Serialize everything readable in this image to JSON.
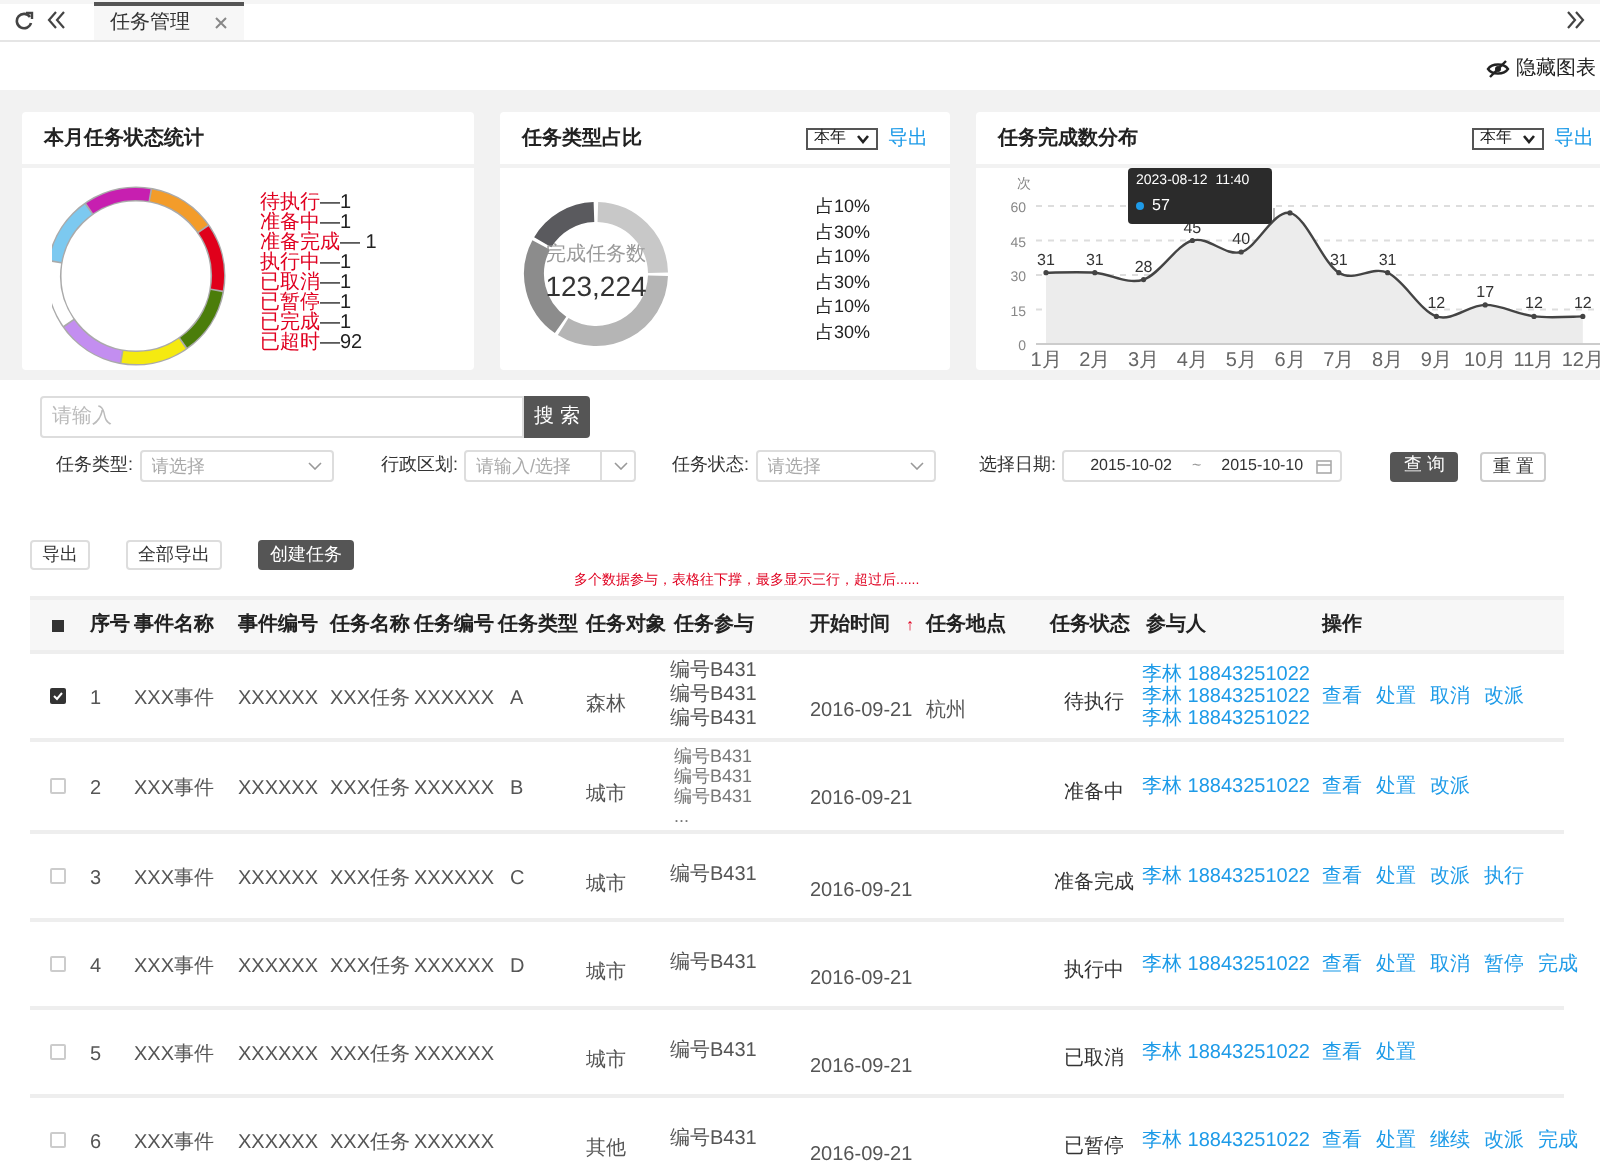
{
  "tab_bar": {
    "tabs": [
      {
        "label": "任务管理",
        "selected": true
      }
    ]
  },
  "hide_charts": "隐藏图表",
  "status_card": {
    "title": "本月任务状态统计",
    "ring_segments": [
      {
        "color": "#c71fb0"
      },
      {
        "color": "#f39c2a"
      },
      {
        "color": "#e0001b"
      },
      {
        "color": "#4b7d0a"
      },
      {
        "color": "#f5ea10"
      },
      {
        "color": "#c38ef0"
      },
      {
        "color": "#ffffff"
      },
      {
        "color": "#7cc9f0"
      }
    ],
    "legend": [
      {
        "label": "待执行",
        "count": "—1"
      },
      {
        "label": "准备中",
        "count": "—1"
      },
      {
        "label": "准备完成",
        "count": "— 1"
      },
      {
        "label": "执行中",
        "count": "—1"
      },
      {
        "label": "已取消",
        "count": "—1"
      },
      {
        "label": "已暂停",
        "count": "—1"
      },
      {
        "label": "已完成",
        "count": "—1"
      },
      {
        "label": "已超时",
        "count": "—92"
      }
    ]
  },
  "type_card": {
    "title": "任务类型占比",
    "period": "本年",
    "export": "导出",
    "center_label": "完成任务数",
    "center_value": "123,224",
    "ring_segments": [
      {
        "color": "#c8c8c8"
      },
      {
        "color": "#b5b5b5"
      },
      {
        "color": "#8c8c8c"
      },
      {
        "color": "#5a5a5e"
      }
    ],
    "legend": [
      "占10%",
      "占30%",
      "占10%",
      "占30%",
      "占10%",
      "占30%"
    ]
  },
  "trend_card": {
    "title": "任务完成数分布",
    "period": "本年",
    "export": "导出",
    "chart_data": {
      "type": "area",
      "grid": true,
      "ylabel": "次",
      "categories": [
        "1月",
        "2月",
        "3月",
        "4月",
        "5月",
        "6月",
        "7月",
        "8月",
        "9月",
        "10月",
        "11月",
        "12月"
      ],
      "values": [
        31,
        31,
        28,
        45,
        40,
        57,
        31,
        31,
        12,
        17,
        12,
        12
      ],
      "yticks": [
        0,
        15,
        30,
        45,
        60
      ],
      "ylim": [
        0,
        60
      ],
      "value_labels": [
        "31",
        "31",
        "28",
        "45",
        "40",
        null,
        "31",
        "31",
        "12",
        "17",
        "12",
        "12"
      ]
    },
    "tooltip": {
      "date": "2023-08-12  11:40",
      "value": "57"
    }
  },
  "search": {
    "placeholder": "请输入",
    "button": "搜 索"
  },
  "filters": [
    {
      "label": "任务类型:",
      "placeholder": "请选择",
      "kind": "select"
    },
    {
      "label": "行政区划:",
      "placeholder": "请输入/选择",
      "kind": "combo"
    },
    {
      "label": "任务状态:",
      "placeholder": "请选择",
      "kind": "select"
    }
  ],
  "date_filter": {
    "label": "选择日期:",
    "start": "2015-10-02",
    "separator": "~",
    "end": "2015-10-10"
  },
  "query_button": "查 询",
  "reset_button": "重 置",
  "actions": [
    {
      "label": "导出",
      "kind": "plain"
    },
    {
      "label": "全部导出",
      "kind": "plain"
    },
    {
      "label": "创建任务",
      "kind": "primary"
    }
  ],
  "note": "多个数据参与，表格往下撑，最多显示三行，超过后......",
  "table": {
    "select_all": {
      "indeterminate": true
    },
    "columns": [
      {
        "label": "序号"
      },
      {
        "label": "事件名称"
      },
      {
        "label": "事件编号"
      },
      {
        "label": "任务名称"
      },
      {
        "label": "任务编号"
      },
      {
        "label": "任务类型"
      },
      {
        "label": "任务对象"
      },
      {
        "label": "任务参与"
      },
      {
        "label": "开始时间",
        "sort_mark": "↑"
      },
      {
        "label": "任务地点"
      },
      {
        "label": "任务状态"
      },
      {
        "label": "参与人"
      },
      {
        "label": "操作"
      }
    ],
    "rows": [
      {
        "checked": true,
        "no": "1",
        "event_name": "XXX事件",
        "event_no": "XXXXXX",
        "task_name": "XXX任务",
        "task_no": "XXXXXX",
        "type": "A",
        "object": "森林",
        "participants": [
          "编号B431",
          "编号B431",
          "编号B431"
        ],
        "start": "2016-09-21",
        "place": "杭州",
        "status": "待执行",
        "people": [
          "李林 18843251022",
          "李林 18843251022",
          "李林 18843251022"
        ],
        "ops": [
          "查看",
          "处置",
          "取消",
          "改派"
        ]
      },
      {
        "checked": false,
        "no": "2",
        "event_name": "XXX事件",
        "event_no": "XXXXXX",
        "task_name": "XXX任务",
        "task_no": "XXXXXX",
        "type": "B",
        "object": "城市",
        "participants": [
          "编号B431",
          "编号B431",
          "编号B431",
          "..."
        ],
        "start": "2016-09-21",
        "status": "准备中",
        "people": [
          "李林 18843251022"
        ],
        "ops": [
          "查看",
          "处置",
          "改派"
        ]
      },
      {
        "checked": false,
        "no": "3",
        "event_name": "XXX事件",
        "event_no": "XXXXXX",
        "task_name": "XXX任务",
        "task_no": "XXXXXX",
        "type": "C",
        "object": "城市",
        "participants": [
          "编号B431"
        ],
        "start": "2016-09-21",
        "status": "准备完成",
        "people": [
          "李林 18843251022"
        ],
        "ops": [
          "查看",
          "处置",
          "改派",
          "执行"
        ]
      },
      {
        "checked": false,
        "no": "4",
        "event_name": "XXX事件",
        "event_no": "XXXXXX",
        "task_name": "XXX任务",
        "task_no": "XXXXXX",
        "type": "D",
        "object": "城市",
        "participants": [
          "编号B431"
        ],
        "start": "2016-09-21",
        "status": "执行中",
        "people": [
          "李林 18843251022"
        ],
        "ops": [
          "查看",
          "处置",
          "取消",
          "暂停",
          "完成"
        ]
      },
      {
        "checked": false,
        "no": "5",
        "event_name": "XXX事件",
        "event_no": "XXXXXX",
        "task_name": "XXX任务",
        "task_no": "XXXXXX",
        "object": "城市",
        "participants": [
          "编号B431"
        ],
        "start": "2016-09-21",
        "status": "已取消",
        "people": [
          "李林 18843251022"
        ],
        "ops": [
          "查看",
          "处置"
        ]
      },
      {
        "checked": false,
        "no": "6",
        "event_name": "XXX事件",
        "event_no": "XXXXXX",
        "task_name": "XXX任务",
        "task_no": "XXXXXX",
        "object": "其他",
        "participants": [
          "编号B431"
        ],
        "start": "2016-09-21",
        "status": "已暂停",
        "people": [
          "李林 18843251022"
        ],
        "ops": [
          "查看",
          "处置",
          "继续",
          "改派",
          "完成"
        ]
      }
    ]
  }
}
